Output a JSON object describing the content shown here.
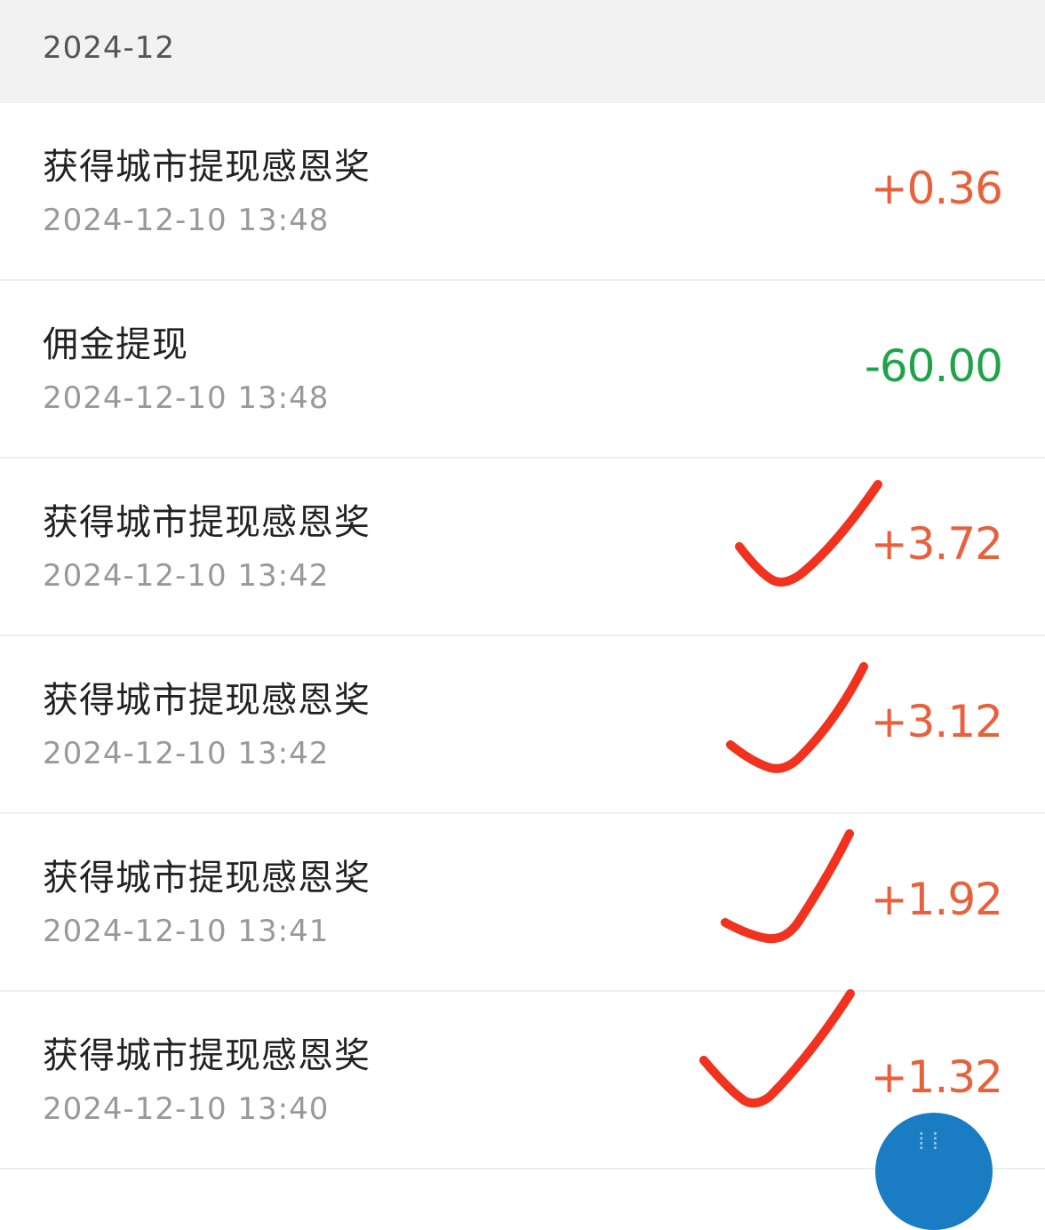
{
  "header": {
    "month": "2024-12"
  },
  "rows": [
    {
      "title": "获得城市提现感恩奖",
      "time": "2024-12-10 13:48",
      "amount": "+0.36",
      "kind": "plus"
    },
    {
      "title": "佣金提现",
      "time": "2024-12-10 13:48",
      "amount": "-60.00",
      "kind": "minus"
    },
    {
      "title": "获得城市提现感恩奖",
      "time": "2024-12-10 13:42",
      "amount": "+3.72",
      "kind": "plus"
    },
    {
      "title": "获得城市提现感恩奖",
      "time": "2024-12-10 13:42",
      "amount": "+3.12",
      "kind": "plus"
    },
    {
      "title": "获得城市提现感恩奖",
      "time": "2024-12-10 13:41",
      "amount": "+1.92",
      "kind": "plus"
    },
    {
      "title": "获得城市提现感恩奖",
      "time": "2024-12-10 13:40",
      "amount": "+1.32",
      "kind": "plus"
    }
  ],
  "colors": {
    "plus": "#e8603c",
    "minus": "#1fa34a",
    "check_mark": "#f0321e",
    "fab": "#1a7cc2"
  },
  "icons": {
    "check_mark": "check-mark-icon",
    "fab": "floating-action-button"
  }
}
